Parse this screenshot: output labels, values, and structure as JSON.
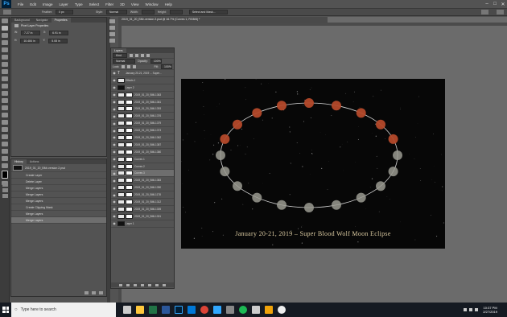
{
  "app": {
    "logo": "Ps",
    "menu": [
      "File",
      "Edit",
      "Image",
      "Layer",
      "Type",
      "Select",
      "Filter",
      "3D",
      "View",
      "Window",
      "Help"
    ],
    "window_controls": [
      "–",
      "□",
      "✕"
    ]
  },
  "options_bar": {
    "feather_label": "Feather:",
    "feather_value": "0 px",
    "style_label": "Style:",
    "style_value": "Normal",
    "width_label": "Width:",
    "height_label": "Height:",
    "select_mask": "Select and Mask..."
  },
  "properties_panel": {
    "tabs": [
      "Background",
      "Navigator",
      "Properties"
    ],
    "active_tab": 2,
    "title": "Pixel Layer Properties",
    "w_label": "W:",
    "w_value": "7.27 in",
    "h_label": "H:",
    "h_value": "10.484 in",
    "x_label": "X:",
    "x_value": "6.91 in",
    "y_label": "Y:",
    "y_value": "5.08 in"
  },
  "history_panel": {
    "tabs": [
      "History",
      "Actions"
    ],
    "snapshot": "2019_01_20_BMr-version 2.psd",
    "items": [
      "Create Layer",
      "Delete Layer",
      "Merge Layers",
      "Merge Layers",
      "Merge Layers",
      "Create Clipping Mask",
      "Merge Layers",
      "Merge Layers"
    ]
  },
  "document": {
    "tab_title": "2019_01_20_BMr-version 2.psd @ 16.7% (Curves 1, RGB/8) *",
    "caption": "January 20-21, 2019 – Super Blood Wolf Moon Eclipse"
  },
  "layers_panel": {
    "title": "Layers",
    "kind": "Kind",
    "blend_mode": "Normal",
    "opacity_label": "Opacity:",
    "opacity_value": "100%",
    "lock_label": "Lock:",
    "fill_label": "Fill:",
    "fill_value": "100%",
    "layers": [
      {
        "name": "January 20-21, 2019 ... Super...",
        "type": "text",
        "selected": false
      },
      {
        "name": "Effects 1",
        "type": "plain",
        "selected": false
      },
      {
        "name": "Layer 2",
        "type": "dark",
        "selected": false
      },
      {
        "name": "2019_01_20_BML1363",
        "type": "mask",
        "selected": false
      },
      {
        "name": "2019_01_20_BML1361",
        "type": "mask",
        "selected": false
      },
      {
        "name": "2019_01_20_BML1393",
        "type": "mask",
        "selected": false
      },
      {
        "name": "2019_01_20_BML1376",
        "type": "mask",
        "selected": false
      },
      {
        "name": "2019_01_20_BML1379",
        "type": "mask",
        "selected": false
      },
      {
        "name": "2019_01_20_BML1373",
        "type": "mask",
        "selected": false
      },
      {
        "name": "2019_01_20_BML1362",
        "type": "mask",
        "selected": false
      },
      {
        "name": "2019_01_20_BML1387",
        "type": "mask",
        "selected": false
      },
      {
        "name": "2019_01_20_BML1380",
        "type": "mask",
        "selected": false
      },
      {
        "name": "Curves 1",
        "type": "adj",
        "selected": false
      },
      {
        "name": "Curves 2",
        "type": "adj",
        "selected": false
      },
      {
        "name": "Curves 3",
        "type": "adj",
        "selected": true
      },
      {
        "name": "2019_01_20_BML1383",
        "type": "mask",
        "selected": false
      },
      {
        "name": "2019_01_20_BML1390",
        "type": "mask",
        "selected": false
      },
      {
        "name": "2019_01_20_BML1178",
        "type": "mask",
        "selected": false
      },
      {
        "name": "2019_01_20_BML1312",
        "type": "mask",
        "selected": false
      },
      {
        "name": "2019_01_20_BML1305",
        "type": "mask",
        "selected": false
      },
      {
        "name": "2019_01_20_BML1301",
        "type": "mask",
        "selected": false
      },
      {
        "name": "Layer 1",
        "type": "dark",
        "selected": false
      }
    ]
  },
  "taskbar": {
    "search_placeholder": "Type here to search",
    "time": "10:37 PM",
    "date": "2/27/2019"
  }
}
